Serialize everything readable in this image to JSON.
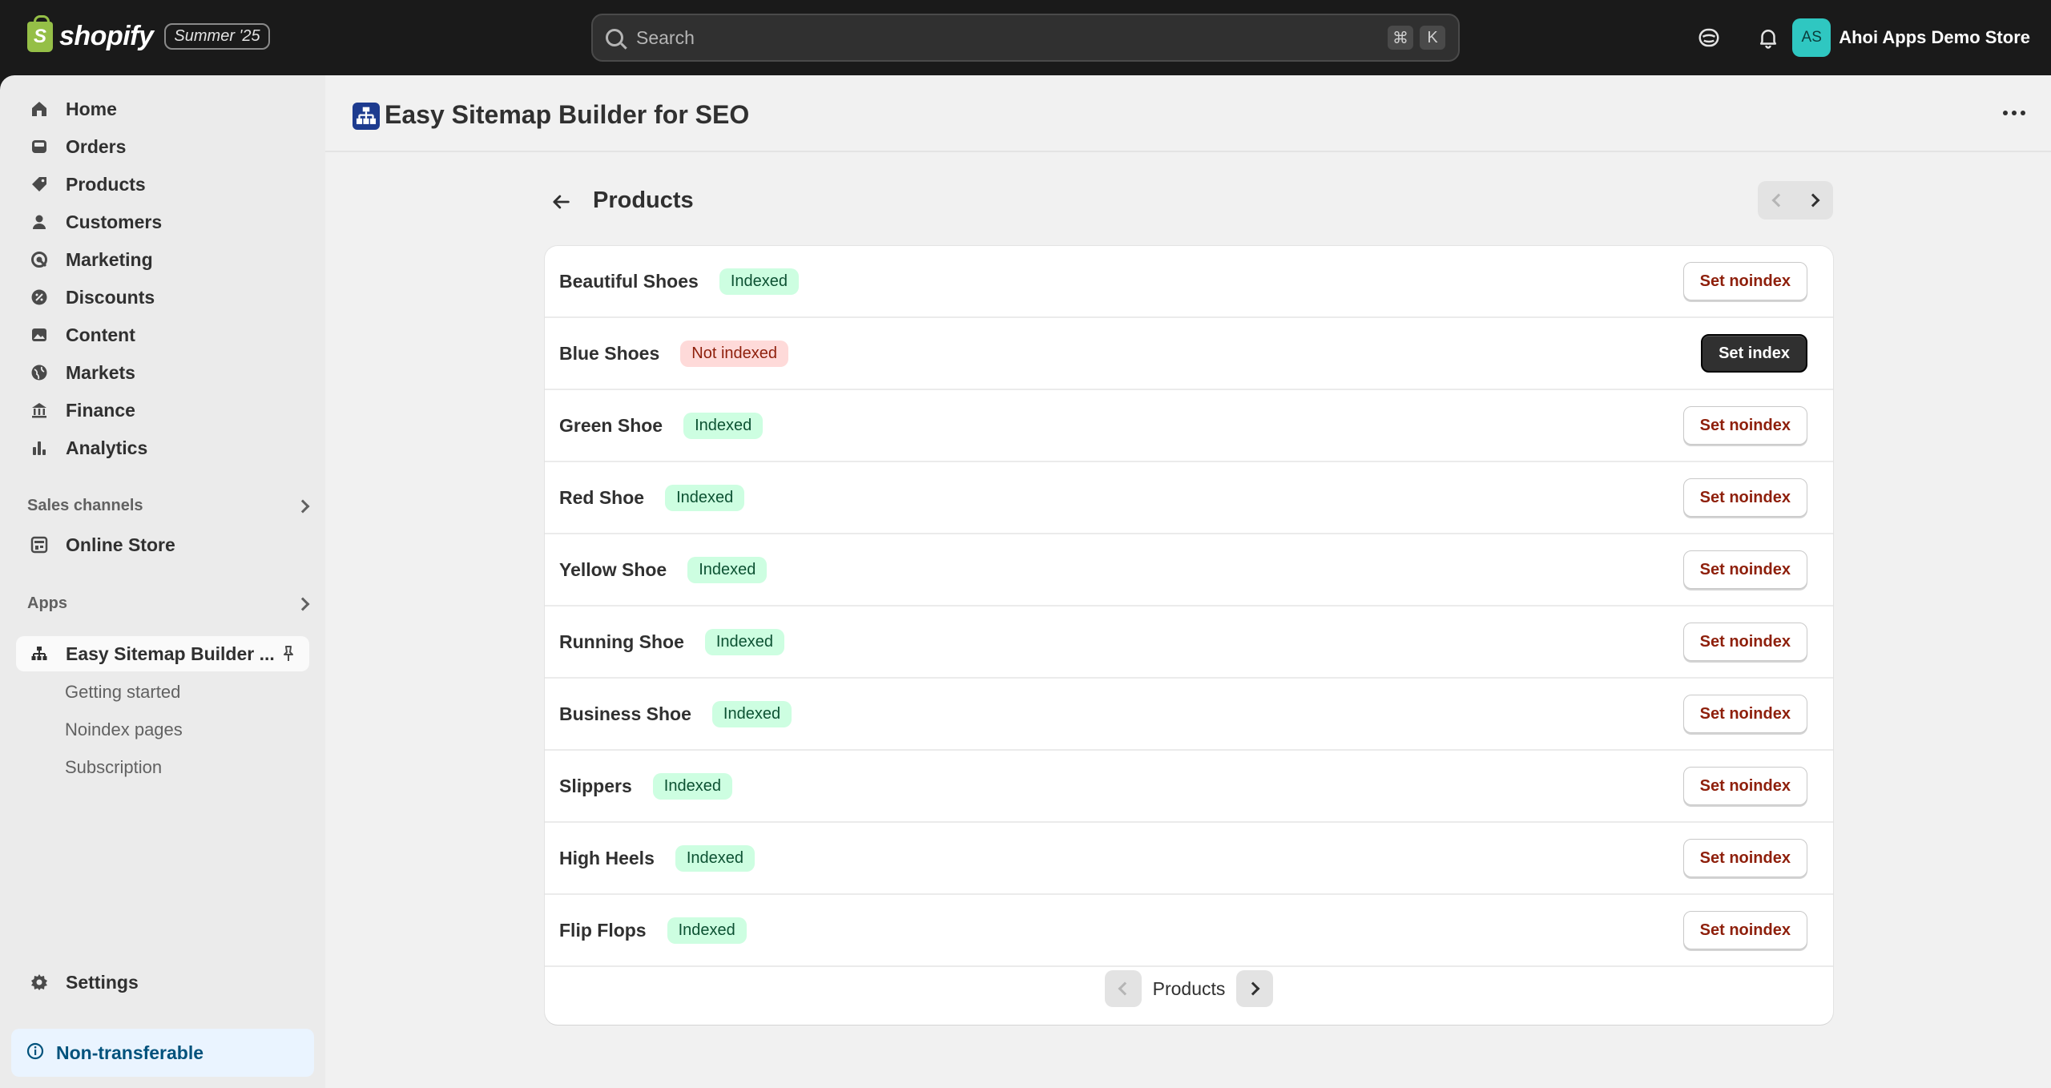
{
  "topbar": {
    "logo_text": "shopify",
    "edition": "Summer '25",
    "search_placeholder": "Search",
    "shortcut_keys": [
      "⌘",
      "K"
    ],
    "store_initials": "AS",
    "store_name": "Ahoi Apps Demo Store"
  },
  "sidebar": {
    "items": [
      {
        "label": "Home",
        "icon": "home-icon"
      },
      {
        "label": "Orders",
        "icon": "orders-icon"
      },
      {
        "label": "Products",
        "icon": "tag-icon"
      },
      {
        "label": "Customers",
        "icon": "person-icon"
      },
      {
        "label": "Marketing",
        "icon": "target-icon"
      },
      {
        "label": "Discounts",
        "icon": "discount-icon"
      },
      {
        "label": "Content",
        "icon": "image-icon"
      },
      {
        "label": "Markets",
        "icon": "globe-icon"
      },
      {
        "label": "Finance",
        "icon": "bank-icon"
      },
      {
        "label": "Analytics",
        "icon": "bar-chart-icon"
      }
    ],
    "sales_channels_label": "Sales channels",
    "online_store_label": "Online Store",
    "apps_label": "Apps",
    "app_item_label": "Easy Sitemap Builder ...",
    "app_subitems": [
      "Getting started",
      "Noindex pages",
      "Subscription"
    ],
    "settings_label": "Settings",
    "non_transferable_label": "Non-transferable"
  },
  "app": {
    "title": "Easy Sitemap Builder for SEO"
  },
  "page": {
    "title": "Products",
    "rows": [
      {
        "name": "Beautiful Shoes",
        "status": "Indexed",
        "action": "Set noindex",
        "state": "indexed"
      },
      {
        "name": "Blue Shoes",
        "status": "Not indexed",
        "action": "Set index",
        "state": "not-indexed"
      },
      {
        "name": "Green Shoe",
        "status": "Indexed",
        "action": "Set noindex",
        "state": "indexed"
      },
      {
        "name": "Red Shoe",
        "status": "Indexed",
        "action": "Set noindex",
        "state": "indexed"
      },
      {
        "name": "Yellow Shoe",
        "status": "Indexed",
        "action": "Set noindex",
        "state": "indexed"
      },
      {
        "name": "Running Shoe",
        "status": "Indexed",
        "action": "Set noindex",
        "state": "indexed"
      },
      {
        "name": "Business Shoe",
        "status": "Indexed",
        "action": "Set noindex",
        "state": "indexed"
      },
      {
        "name": "Slippers",
        "status": "Indexed",
        "action": "Set noindex",
        "state": "indexed"
      },
      {
        "name": "High Heels",
        "status": "Indexed",
        "action": "Set noindex",
        "state": "indexed"
      },
      {
        "name": "Flip Flops",
        "status": "Indexed",
        "action": "Set noindex",
        "state": "indexed"
      }
    ],
    "pagination_label": "Products"
  },
  "colors": {
    "indexed_bg": "#cdfee1",
    "not_indexed_bg": "#fedad9",
    "avatar": "#2fc7c1",
    "noindex_text": "#8e1f0b"
  }
}
